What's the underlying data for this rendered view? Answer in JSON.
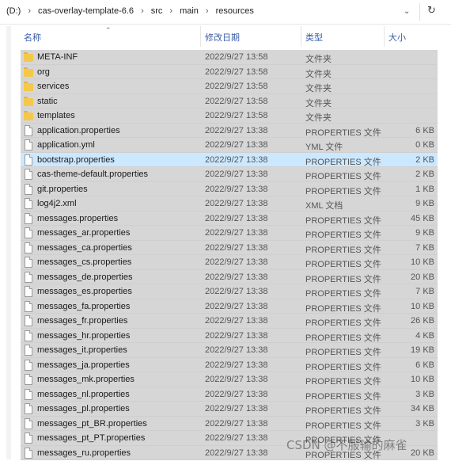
{
  "address": {
    "crumbs": [
      "(D:)",
      "cas-overlay-template-6.6",
      "src",
      "main",
      "resources"
    ],
    "separator": "›",
    "dropdown_icon": "chevron-down-icon",
    "refresh_icon": "refresh-icon"
  },
  "columns": {
    "name": "名称",
    "date": "修改日期",
    "type": "类型",
    "size": "大小"
  },
  "files": [
    {
      "name": "META-INF",
      "date": "2022/9/27 13:58",
      "type": "文件夹",
      "size": "",
      "kind": "folder"
    },
    {
      "name": "org",
      "date": "2022/9/27 13:58",
      "type": "文件夹",
      "size": "",
      "kind": "folder"
    },
    {
      "name": "services",
      "date": "2022/9/27 13:58",
      "type": "文件夹",
      "size": "",
      "kind": "folder"
    },
    {
      "name": "static",
      "date": "2022/9/27 13:58",
      "type": "文件夹",
      "size": "",
      "kind": "folder"
    },
    {
      "name": "templates",
      "date": "2022/9/27 13:58",
      "type": "文件夹",
      "size": "",
      "kind": "folder"
    },
    {
      "name": "application.properties",
      "date": "2022/9/27 13:38",
      "type": "PROPERTIES 文件",
      "size": "6 KB",
      "kind": "file"
    },
    {
      "name": "application.yml",
      "date": "2022/9/27 13:38",
      "type": "YML 文件",
      "size": "0 KB",
      "kind": "file"
    },
    {
      "name": "bootstrap.properties",
      "date": "2022/9/27 13:38",
      "type": "PROPERTIES 文件",
      "size": "2 KB",
      "kind": "file",
      "selected": true
    },
    {
      "name": "cas-theme-default.properties",
      "date": "2022/9/27 13:38",
      "type": "PROPERTIES 文件",
      "size": "2 KB",
      "kind": "file"
    },
    {
      "name": "git.properties",
      "date": "2022/9/27 13:38",
      "type": "PROPERTIES 文件",
      "size": "1 KB",
      "kind": "file"
    },
    {
      "name": "log4j2.xml",
      "date": "2022/9/27 13:38",
      "type": "XML 文档",
      "size": "9 KB",
      "kind": "file"
    },
    {
      "name": "messages.properties",
      "date": "2022/9/27 13:38",
      "type": "PROPERTIES 文件",
      "size": "45 KB",
      "kind": "file"
    },
    {
      "name": "messages_ar.properties",
      "date": "2022/9/27 13:38",
      "type": "PROPERTIES 文件",
      "size": "9 KB",
      "kind": "file"
    },
    {
      "name": "messages_ca.properties",
      "date": "2022/9/27 13:38",
      "type": "PROPERTIES 文件",
      "size": "7 KB",
      "kind": "file"
    },
    {
      "name": "messages_cs.properties",
      "date": "2022/9/27 13:38",
      "type": "PROPERTIES 文件",
      "size": "10 KB",
      "kind": "file"
    },
    {
      "name": "messages_de.properties",
      "date": "2022/9/27 13:38",
      "type": "PROPERTIES 文件",
      "size": "20 KB",
      "kind": "file"
    },
    {
      "name": "messages_es.properties",
      "date": "2022/9/27 13:38",
      "type": "PROPERTIES 文件",
      "size": "7 KB",
      "kind": "file"
    },
    {
      "name": "messages_fa.properties",
      "date": "2022/9/27 13:38",
      "type": "PROPERTIES 文件",
      "size": "10 KB",
      "kind": "file"
    },
    {
      "name": "messages_fr.properties",
      "date": "2022/9/27 13:38",
      "type": "PROPERTIES 文件",
      "size": "26 KB",
      "kind": "file"
    },
    {
      "name": "messages_hr.properties",
      "date": "2022/9/27 13:38",
      "type": "PROPERTIES 文件",
      "size": "4 KB",
      "kind": "file"
    },
    {
      "name": "messages_it.properties",
      "date": "2022/9/27 13:38",
      "type": "PROPERTIES 文件",
      "size": "19 KB",
      "kind": "file"
    },
    {
      "name": "messages_ja.properties",
      "date": "2022/9/27 13:38",
      "type": "PROPERTIES 文件",
      "size": "6 KB",
      "kind": "file"
    },
    {
      "name": "messages_mk.properties",
      "date": "2022/9/27 13:38",
      "type": "PROPERTIES 文件",
      "size": "10 KB",
      "kind": "file"
    },
    {
      "name": "messages_nl.properties",
      "date": "2022/9/27 13:38",
      "type": "PROPERTIES 文件",
      "size": "3 KB",
      "kind": "file"
    },
    {
      "name": "messages_pl.properties",
      "date": "2022/9/27 13:38",
      "type": "PROPERTIES 文件",
      "size": "34 KB",
      "kind": "file"
    },
    {
      "name": "messages_pt_BR.properties",
      "date": "2022/9/27 13:38",
      "type": "PROPERTIES 文件",
      "size": "3 KB",
      "kind": "file"
    },
    {
      "name": "messages_pt_PT.properties",
      "date": "2022/9/27 13:38",
      "type": "PROPERTIES 文件",
      "size": "",
      "kind": "file"
    },
    {
      "name": "messages_ru.properties",
      "date": "2022/9/27 13:38",
      "type": "PROPERTIES 文件",
      "size": "20 KB",
      "kind": "file"
    }
  ],
  "watermark": "CSDN @不服输的麻雀",
  "colors": {
    "row_bg": "#d6d6d6",
    "selected_bg": "#cce8ff",
    "header_text": "#3b5ea8",
    "folder": "#f5c84c"
  }
}
